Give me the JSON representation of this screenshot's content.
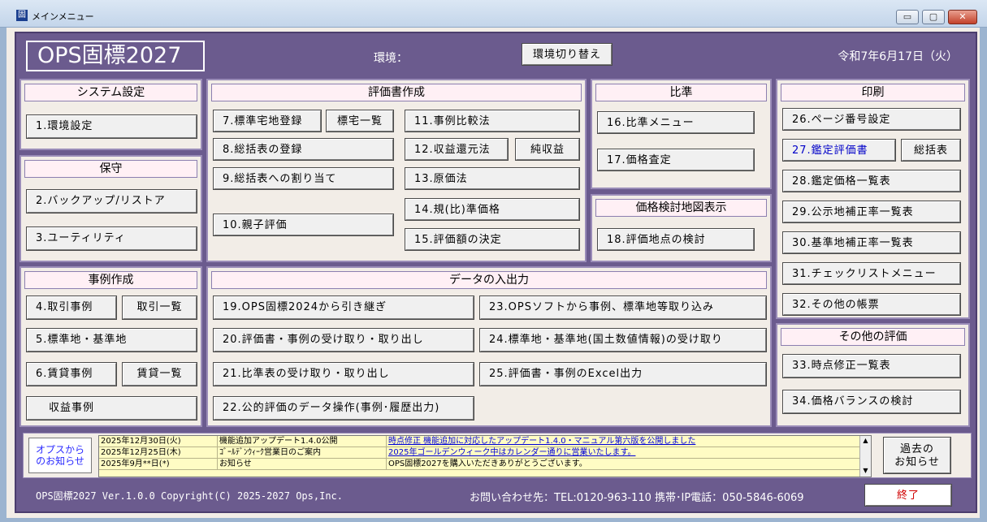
{
  "window": {
    "title": "メインメニュー",
    "icon_char": "固",
    "min": "▭",
    "max": "▢",
    "close": "✕"
  },
  "header": {
    "app_title": "OPS固標2027",
    "env_label": "環境：",
    "env_button": "環境切り替え",
    "date": "令和7年6月17日（火）"
  },
  "system": {
    "title": "システム設定",
    "b1": "1.環境設定"
  },
  "maintenance": {
    "title": "保守",
    "b2": "2.バックアップ/リストア",
    "b3": "3.ユーティリティ"
  },
  "cases": {
    "title": "事例作成",
    "b4": "4.取引事例",
    "b4_list": "取引一覧",
    "b5": "5.標準地・基準地",
    "b6": "6.賃貸事例",
    "b6_list": "賃貸一覧",
    "b_income": "収益事例"
  },
  "appraisal": {
    "title": "評価書作成",
    "b7": "7.標準宅地登録",
    "b7_list": "標宅一覧",
    "b8": "8.総括表の登録",
    "b9": "9.総括表への割り当て",
    "b10": "10.親子評価",
    "b11": "11.事例比較法",
    "b12": "12.収益還元法",
    "b12_net": "純収益",
    "b13": "13.原価法",
    "b14": "14.規(比)準価格",
    "b15": "15.評価額の決定"
  },
  "comparison": {
    "title": "比準",
    "b16": "16.比準メニュー",
    "b17": "17.価格査定"
  },
  "map": {
    "title": "価格検討地図表示",
    "b18": "18.評価地点の検討"
  },
  "io": {
    "title": "データの入出力",
    "b19": "19.OPS固標2024から引き継ぎ",
    "b20": "20.評価書・事例の受け取り・取り出し",
    "b21": "21.比準表の受け取り・取り出し",
    "b22": "22.公的評価のデータ操作(事例･履歴出力)",
    "b23": "23.OPSソフトから事例、標準地等取り込み",
    "b24": "24.標準地・基準地(国土数値情報)の受け取り",
    "b25": "25.評価書・事例のExcel出力"
  },
  "print": {
    "title": "印刷",
    "b26": "26.ページ番号設定",
    "b27": "27.鑑定評価書",
    "b27_summary": "総括表",
    "b28": "28.鑑定価格一覧表",
    "b29": "29.公示地補正率一覧表",
    "b30": "30.基準地補正率一覧表",
    "b31": "31.チェックリストメニュー",
    "b32": "32.その他の帳票"
  },
  "other_eval": {
    "title": "その他の評価",
    "b33": "33.時点修正一覧表",
    "b34": "34.価格バランスの検討"
  },
  "news": {
    "label": "オプスから\nのお知らせ",
    "rows": [
      {
        "date": "2025年12月30日(火)",
        "title": "機能追加アップデート1.4.0公開",
        "body": "時点修正 機能追加に対応したアップデート1.4.0・マニュアル第六版を公開しました",
        "link": true
      },
      {
        "date": "2025年12月25日(木)",
        "title": "ｺﾞｰﾙﾃﾞﾝｳｨｰｸ営業日のご案内",
        "body": "2025年ゴールデンウィーク中はカレンダー通りに営業いたします。",
        "link": true
      },
      {
        "date": "2025年9月**日(*)",
        "title": "お知らせ",
        "body": "OPS固標2027を購入いただきありがとうございます。",
        "link": false
      }
    ],
    "past_button": "過去の\nお知らせ",
    "scroll_up": "▲",
    "scroll_down": "▼"
  },
  "footer": {
    "copyright": "OPS固標2027 Ver.1.0.0 Copyright(C) 2025-2027  Ops,Inc.",
    "contact": "お問い合わせ先：TEL:0120-963-110  携帯･IP電話：050-5846-6069",
    "exit": "終了"
  }
}
